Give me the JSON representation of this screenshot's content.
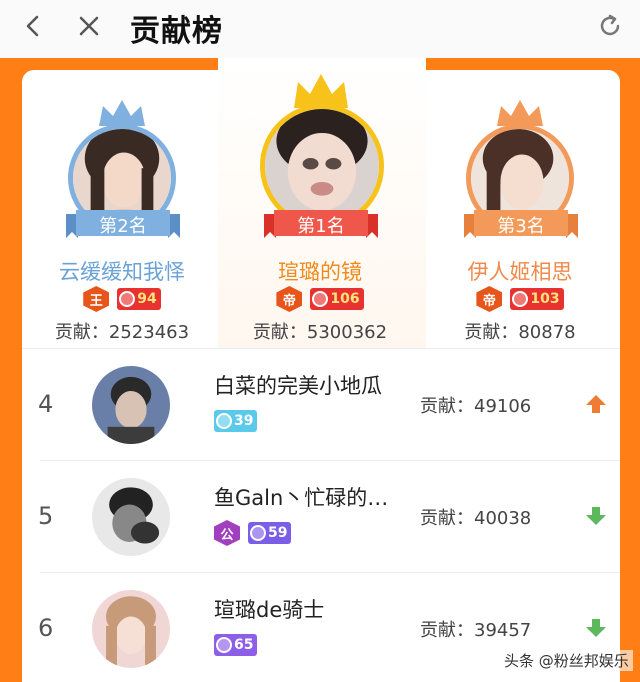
{
  "header": {
    "title": "贡献榜"
  },
  "podium": [
    {
      "slot": "p2",
      "rank_label": "第2名",
      "name": "云缓缓知我怿",
      "rank_badge": "王",
      "level": "94",
      "contribution": "贡献：2523463"
    },
    {
      "slot": "p1",
      "rank_label": "第1名",
      "name": "瑄璐的镜",
      "rank_badge": "帝",
      "level": "106",
      "contribution": "贡献：5300362"
    },
    {
      "slot": "p3",
      "rank_label": "第3名",
      "name": "伊人姬相思",
      "rank_badge": "帝",
      "level": "103",
      "contribution": "贡献：80878"
    }
  ],
  "list": [
    {
      "rank": "4",
      "name": "白菜的完美小地瓜",
      "level": "39",
      "contribution": "贡献：49106",
      "trend": "up"
    },
    {
      "rank": "5",
      "name": "鱼Galn丶忙碌的…",
      "badge": "公",
      "level": "59",
      "contribution": "贡献：40038",
      "trend": "down"
    },
    {
      "rank": "6",
      "name": "瑄璐de骑士",
      "level": "65",
      "contribution": "贡献：39457",
      "trend": "down"
    }
  ],
  "watermark": "头条 @粉丝邦娱乐",
  "colors": {
    "accent_orange": "#ff7f16",
    "trend_up": "#f07b32",
    "trend_down": "#5cb85c"
  }
}
